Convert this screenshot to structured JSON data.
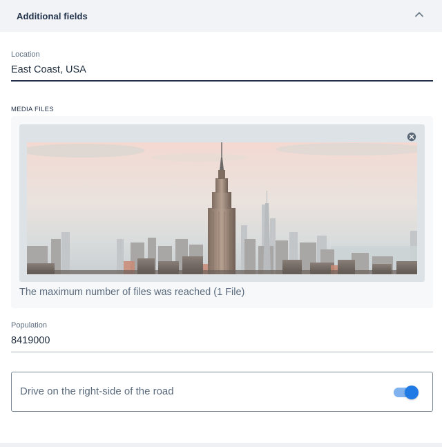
{
  "section": {
    "title": "Additional fields",
    "chevron_icon": "chevron-up-icon"
  },
  "location": {
    "label": "Location",
    "value": "East Coast, USA"
  },
  "media": {
    "label": "MEDIA FILES",
    "image_icon": "city-skyline-photo",
    "remove_icon": "close-circle-icon",
    "note": "The maximum number of files was reached (1 File)"
  },
  "population": {
    "label": "Population",
    "value": "8419000"
  },
  "drive_toggle": {
    "label": "Drive on the right-side of the road",
    "checked": true
  },
  "colors": {
    "accent": "#1f7ae6",
    "accent_track": "#7fb2ee",
    "header_bg": "#f1f3f6",
    "text_dark": "#1f2d3d",
    "text_muted": "#5b6b7d"
  }
}
